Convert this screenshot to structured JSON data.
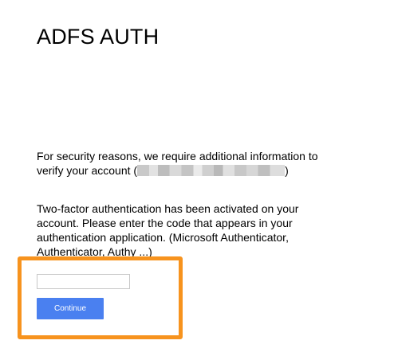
{
  "header": {
    "title": "ADFS AUTH"
  },
  "messages": {
    "security_text": "For security reasons, we require additional information to verify your account (",
    "security_close": ")",
    "two_factor_text": "Two-factor authentication has been activated on your account. Please enter the code that appears in your authentication application. (Microsoft Authenticator, Authenticator, Authy ...)"
  },
  "form": {
    "code_value": "",
    "code_placeholder": "",
    "continue_label": "Continue"
  },
  "colors": {
    "highlight": "#f7931e",
    "button": "#4a80f0"
  }
}
